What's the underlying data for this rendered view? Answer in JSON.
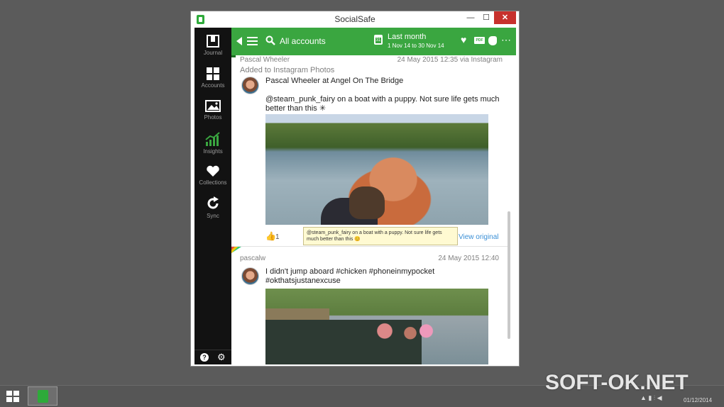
{
  "window": {
    "title": "SocialSafe",
    "minimize": "—",
    "maximize": "☐",
    "close": "✕"
  },
  "sidebar": {
    "items": [
      {
        "label": "Journal",
        "icon": "journal-icon"
      },
      {
        "label": "Accounts",
        "icon": "grid-icon"
      },
      {
        "label": "Photos",
        "icon": "photo-icon"
      },
      {
        "label": "Insights",
        "icon": "chart-icon"
      },
      {
        "label": "Collections",
        "icon": "heart-icon"
      },
      {
        "label": "Sync",
        "icon": "sync-icon"
      }
    ],
    "help": "?",
    "settings": "⚙"
  },
  "toolbar": {
    "accounts_label": "All accounts",
    "period_label": "Last month",
    "period_range": "1 Nov 14 to 30 Nov 14",
    "calendar_day": "31",
    "pdf_label": "PDF",
    "heart": "♥",
    "more": "⋯"
  },
  "posts": [
    {
      "author": "Pascal Wheeler",
      "meta": "24 May 2015 12:35 via Instagram",
      "added": "Added to Instagram Photos",
      "title": "Pascal Wheeler at Angel On The Bridge",
      "text": "@steam_punk_fairy on a boat with a puppy. Not sure life gets much better than this ✳",
      "likes": "1",
      "view_original": "View original",
      "tooltip": "@steam_punk_fairy on a boat with a puppy. Not sure life gets much better than this 😊"
    },
    {
      "author": "pascalw",
      "meta": "24 May 2015 12:40",
      "text": "I didn't jump aboard #chicken #phoneinmypocket #okthatsjustanexcuse"
    }
  ],
  "taskbar": {
    "date": "01/12/2014",
    "watermark": "SOFT-OK.NET",
    "tray": "▲ ▮ ⫶ ◀"
  },
  "colors": {
    "accent": "#3aa640",
    "sidebar": "#121212",
    "close": "#c7312d",
    "link": "#3a8fd6"
  }
}
